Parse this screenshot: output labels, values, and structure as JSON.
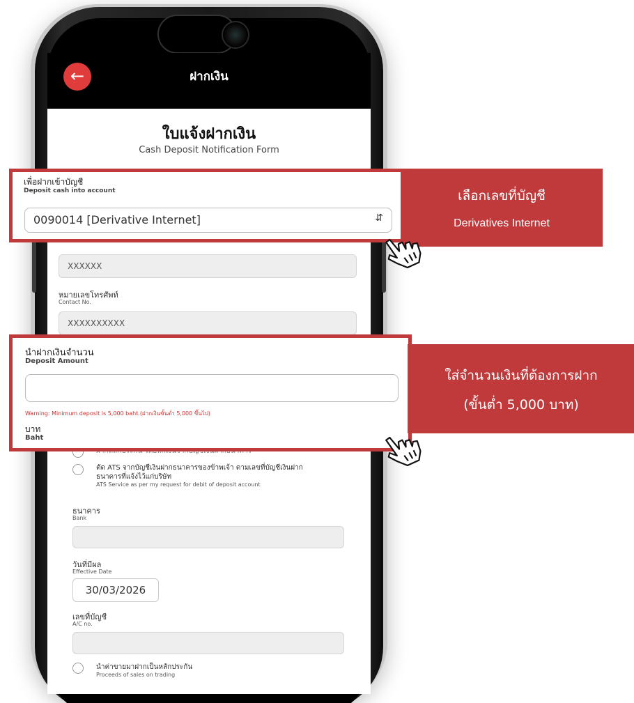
{
  "header": {
    "title": "ฝากเงิน"
  },
  "form": {
    "title_th": "ใบแจ้งฝากเงิน",
    "title_en": "Cash Deposit Notification Form",
    "account": {
      "label_th": "เพื่อฝากเข้าบัญชี",
      "label_en": "Deposit cash into account",
      "selected": "0090014 [Derivative Internet]"
    },
    "name_field_value": "XXXXXX",
    "contact": {
      "label_th": "หมายเลขโทรศัพท์",
      "label_en": "Contact No.",
      "value": "XXXXXXXXXX"
    },
    "amount": {
      "label_th": "นำฝากเงินจำนวน",
      "label_en": "Deposit Amount",
      "value": "",
      "warning": "Warning: Minimum deposit is 5,000 baht.(ฝากเงินขั้นต่ำ 5,000 ขึ้นไป)",
      "unit_th": "บาท",
      "unit_en": "Baht"
    },
    "options": [
      {
        "th": "ฝากหลักประกัน โดยหักเงินจากบัญชีเงินฝากธนาคาร",
        "en": ""
      },
      {
        "th": "ตัด ATS จากบัญชีเงินฝากธนาคารของข้าพเจ้า ตามเลขที่บัญชีเงินฝาก",
        "th2": "ธนาคารที่แจ้งไว้แก่บริษัท",
        "en": "ATS Service as per my request for debit of deposit account"
      },
      {
        "th": "นำค่าขายมาฝากเป็นหลักประกัน",
        "en": "Proceeds of sales on trading"
      }
    ],
    "bank": {
      "label_th": "ธนาคาร",
      "label_en": "Bank",
      "value": ""
    },
    "effective_date": {
      "label_th": "วันที่มีผล",
      "label_en": "Effective Date",
      "value": "30/03/2026"
    },
    "ac_no": {
      "label_th": "เลขที่บัญชี",
      "label_en": "A/C no.",
      "value": ""
    }
  },
  "callouts": {
    "account_note": {
      "line1": "เลือกเลขที่บัญชี",
      "line2": "Derivatives Internet"
    },
    "amount_note": {
      "line1": "ใส่จำนวนเงินที่ต้องการฝาก",
      "line2": "(ขั้นต่ำ 5,000 บาท)"
    }
  },
  "colors": {
    "accent": "#c0393b",
    "back_button": "#e03c3c",
    "warning": "#d52b2b"
  },
  "icons": {
    "back": "arrow-left-icon",
    "select": "chevron-up-down-icon",
    "pointer": "hand-pointer-icon"
  }
}
